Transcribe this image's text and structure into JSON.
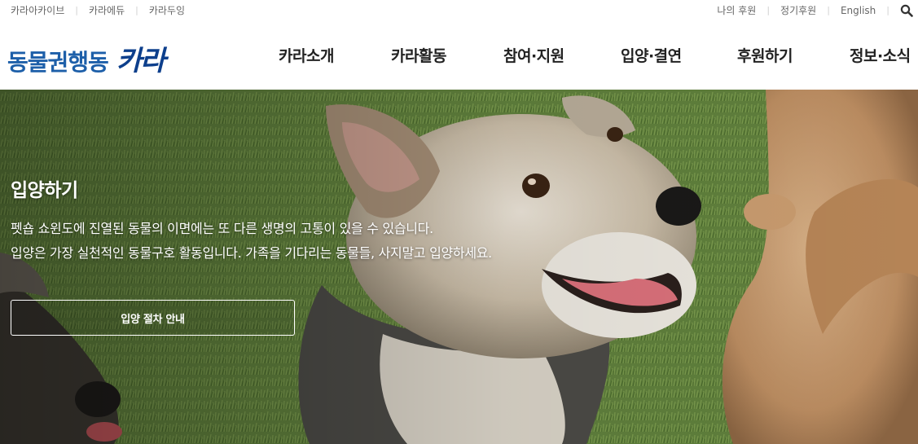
{
  "util": {
    "left_links": [
      "카라아카이브",
      "카라에듀",
      "카라두잉"
    ],
    "right_links": [
      "나의 후원",
      "정기후원",
      "English"
    ]
  },
  "header": {
    "logo_text": "동물권행동",
    "logo_brand": "카라",
    "nav": [
      "카라소개",
      "카라활동",
      "참여·지원",
      "입양·결연",
      "후원하기",
      "정보·소식"
    ]
  },
  "hero": {
    "title": "입양하기",
    "desc_lines": [
      "펫숍 쇼윈도에 진열된 동물의 이면에는 또 다른 생명의 고통이 있을 수 있습니다.",
      "입양은 가장 실천적인 동물구호 활동입니다. 가족을 기다리는 동물들, 사지말고 입양하세요."
    ],
    "button_label": "입양 절차 안내"
  },
  "colors": {
    "brand_blue": "#1d5fa9",
    "brand_dark": "#0d3f8c",
    "grass_green": "#5b7a3a"
  },
  "icons": {
    "search": "search-icon"
  }
}
